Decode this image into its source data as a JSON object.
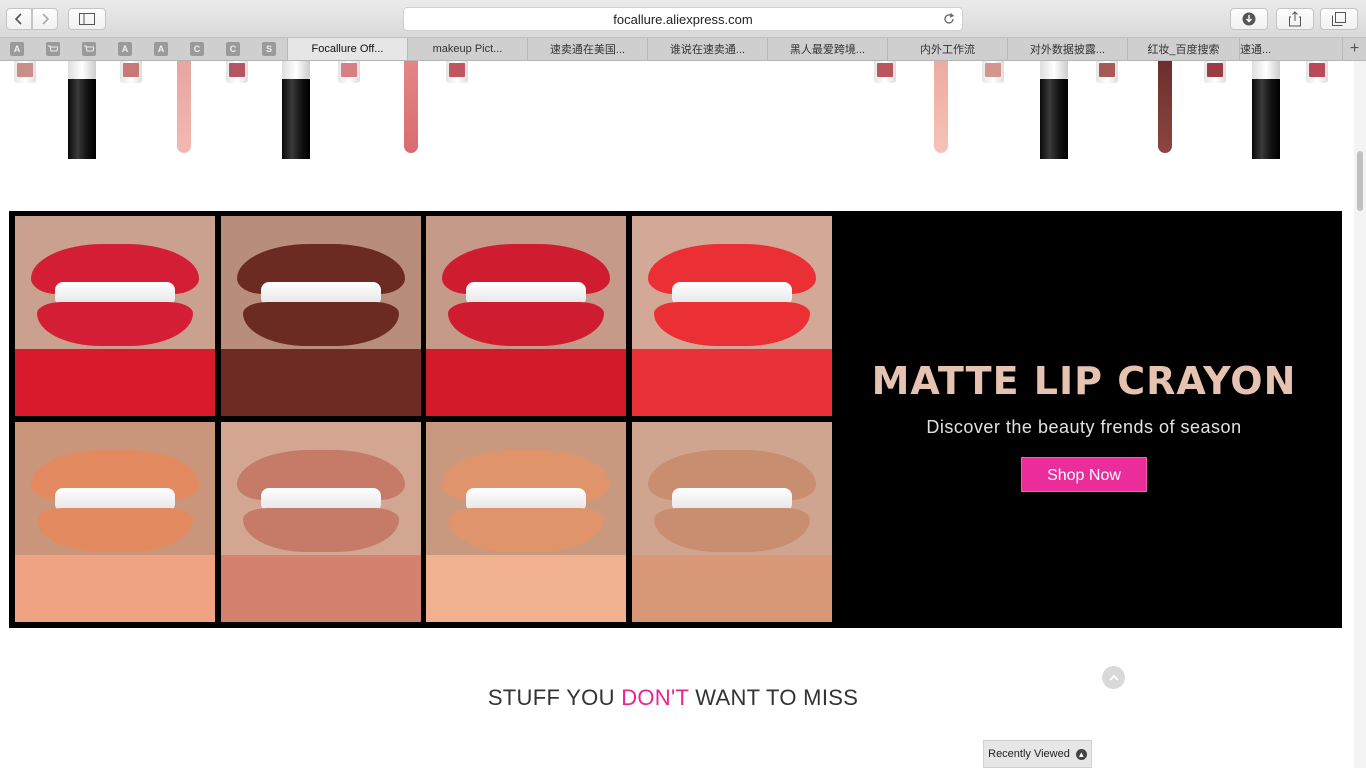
{
  "browser": {
    "url": "focallure.aliexpress.com",
    "pinned_tabs": [
      "A",
      "",
      "",
      "A",
      "A",
      "C",
      "C",
      "S"
    ],
    "tabs": [
      {
        "label": "Focallure Off...",
        "active": true
      },
      {
        "label": "makeup Pict...",
        "active": false
      },
      {
        "label": "速卖通在美国...",
        "active": false
      },
      {
        "label": "谁说在速卖通...",
        "active": false
      },
      {
        "label": "黑人最爱跨境...",
        "active": false
      },
      {
        "label": "内外工作流",
        "active": false
      },
      {
        "label": "对外数据披露...",
        "active": false
      },
      {
        "label": "红妆_百度搜索",
        "active": false
      },
      {
        "label": "速通...",
        "active": false
      }
    ],
    "new_tab_symbol": "+"
  },
  "banner": {
    "title": "MATTE LIP CRAYON",
    "subtitle": "Discover the beauty frends of season",
    "cta_label": "Shop Now",
    "accent_color": "#ea2d9b",
    "title_color": "#e6c3b0"
  },
  "lip_swatches": [
    {
      "lip": "#d31e35",
      "swatch": "#d81a2c",
      "skin": "#caa18f"
    },
    {
      "lip": "#6b2a22",
      "swatch": "#6e2b24",
      "skin": "#b88d7c"
    },
    {
      "lip": "#cf1c30",
      "swatch": "#d21a2b",
      "skin": "#c59a89"
    },
    {
      "lip": "#ea3034",
      "swatch": "#e83238",
      "skin": "#d4a896"
    },
    {
      "lip": "#e48a60",
      "swatch": "#f0a382",
      "skin": "#c9967b"
    },
    {
      "lip": "#c57b68",
      "swatch": "#d4826f",
      "skin": "#d2a690"
    },
    {
      "lip": "#e0946c",
      "swatch": "#f1b08e",
      "skin": "#c8997f"
    },
    {
      "lip": "#c98d70",
      "swatch": "#d89777",
      "skin": "#cfa58f"
    }
  ],
  "section": {
    "heading_pre": "STUFF YOU ",
    "heading_accent": "DON'T",
    "heading_post": " WANT TO MISS"
  },
  "recently_viewed_label": "Recently Viewed"
}
